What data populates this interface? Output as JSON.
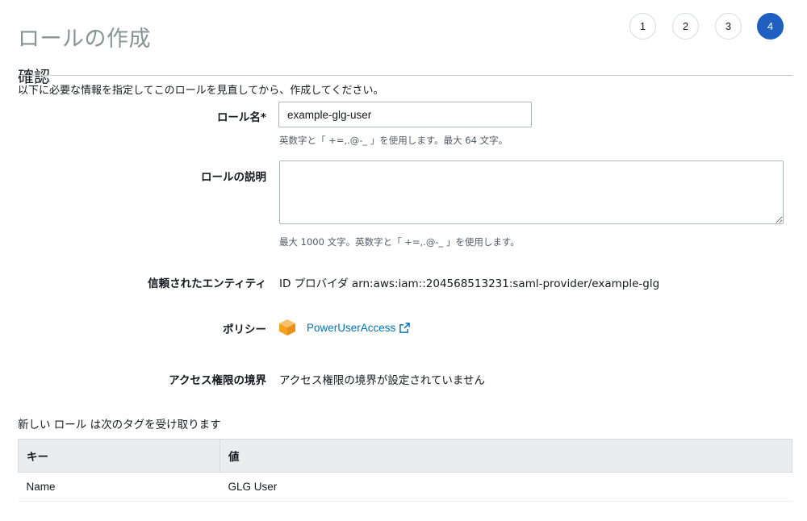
{
  "header": {
    "title": "ロールの作成",
    "steps": [
      "1",
      "2",
      "3",
      "4"
    ],
    "active_step": "4"
  },
  "section": {
    "title": "確認",
    "intro": "以下に必要な情報を指定してこのロールを見直してから、作成してください。"
  },
  "form": {
    "role_name_label": "ロール名*",
    "role_name_value": "example-glg-user",
    "role_name_hint": "英数字と「 +=,.@-_ 」を使用します。最大 64 文字。",
    "description_label": "ロールの説明",
    "description_value": "",
    "description_hint": "最大 1000 文字。英数字と「 +=,.@-_ 」を使用します。",
    "trusted_entity_label": "信頼されたエンティティ",
    "trusted_entity_value": "ID プロバイダ arn:aws:iam::204568513231:saml-provider/example-glg",
    "policy_label": "ポリシー",
    "policy_link": "PowerUserAccess",
    "boundary_label": "アクセス権限の境界",
    "boundary_value": "アクセス権限の境界が設定されていません"
  },
  "tags": {
    "intro": "新しい ロール は次のタグを受け取ります",
    "columns": [
      "キー",
      "値"
    ],
    "rows": [
      {
        "key": "Name",
        "value": "GLG User"
      }
    ]
  },
  "icons": {
    "policy": "policy-cube-icon",
    "external_link": "external-link-icon"
  },
  "colors": {
    "accent": "#1e5fbf",
    "link": "#0073bb",
    "policy_icon": "#f7a41d"
  }
}
